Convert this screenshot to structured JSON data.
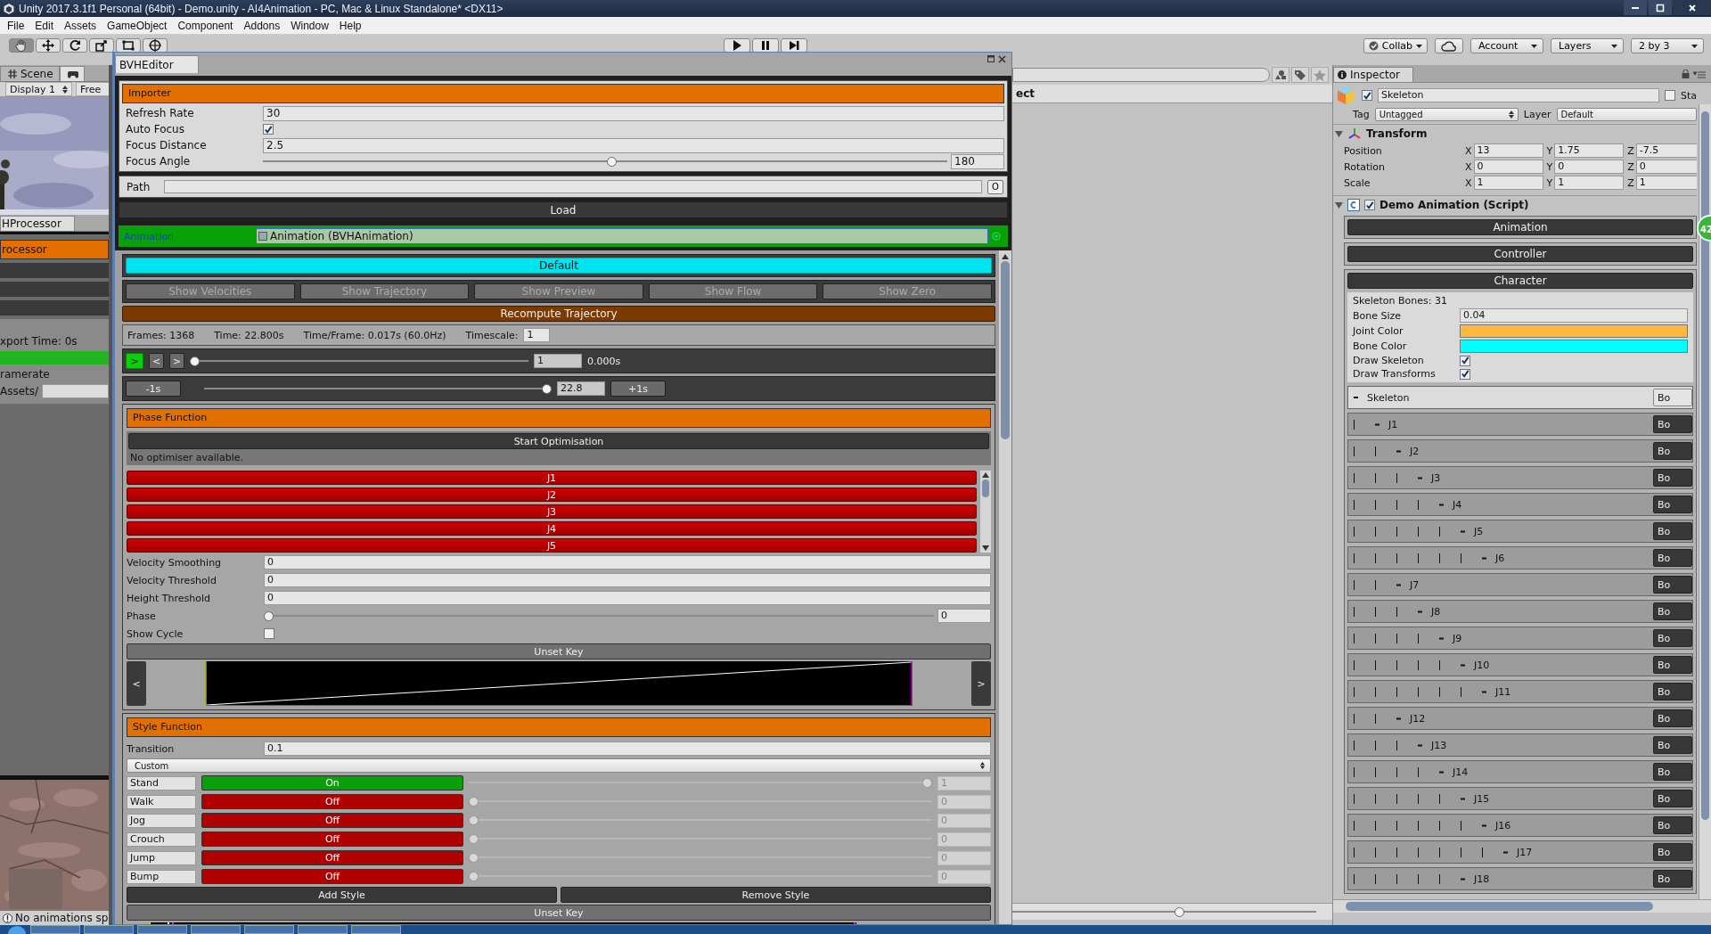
{
  "window": {
    "title": "Unity 2017.3.1f1 Personal (64bit) - Demo.unity - AI4Animation - PC, Mac & Linux Standalone* <DX11>"
  },
  "menu": [
    "File",
    "Edit",
    "Assets",
    "GameObject",
    "Component",
    "Addons",
    "Window",
    "Help"
  ],
  "toolbar": {
    "tools": [
      {
        "kind": "hand",
        "selected": true
      },
      {
        "kind": "move",
        "selected": false
      },
      {
        "kind": "rotate",
        "selected": false
      },
      {
        "kind": "scale",
        "selected": false
      },
      {
        "kind": "rect",
        "selected": false
      },
      {
        "kind": "transform",
        "selected": false
      }
    ],
    "playback": [
      {
        "kind": "play"
      },
      {
        "kind": "pause"
      },
      {
        "kind": "step"
      }
    ],
    "collab": "Collab",
    "account": "Account",
    "layers": "Layers",
    "layout": "2 by 3"
  },
  "scene_view": {
    "tabs": [
      {
        "label": "Scene",
        "selected": false
      },
      {
        "kind": "game",
        "selected": true
      }
    ],
    "display": "Display 1",
    "aspect": "Free"
  },
  "processor": {
    "tab": "HProcessor",
    "header": "rocessor",
    "export_time": "xport Time: 0s",
    "progress": {
      "level": 1
    },
    "framerate": "ramerate",
    "folder": "Assets/"
  },
  "status_bar": {
    "message": "No animations sp"
  },
  "project": {
    "header": "ect",
    "zoom": {
      "level": 0.55
    }
  },
  "editor": {
    "tab": "BVHEditor",
    "importer": {
      "title": "Importer",
      "fields": [
        {
          "kind": "text",
          "label": "Refresh Rate",
          "value": "30"
        },
        {
          "kind": "checkbox",
          "label": "Auto Focus",
          "checked": true
        },
        {
          "kind": "text",
          "label": "Focus Distance",
          "value": "2.5"
        },
        {
          "kind": "slider",
          "label": "Focus Angle",
          "level": 0.51,
          "value": "180"
        }
      ],
      "path": {
        "label": "Path",
        "button": "O"
      },
      "load": "Load"
    },
    "animation": {
      "label": "Animation",
      "value": "Animation (BVHAnimation)"
    },
    "default_button": "Default",
    "toggles": [
      {
        "label": "Show Velocities",
        "on": false
      },
      {
        "label": "Show Trajectory",
        "on": false
      },
      {
        "label": "Show Preview",
        "on": false
      },
      {
        "label": "Show Flow",
        "on": false
      },
      {
        "label": "Show Zero",
        "on": false
      }
    ],
    "recompute": "Recompute Trajectory",
    "info": [
      "Frames: 1368",
      "Time: 22.800s",
      "Time/Frame: 0.017s (60.0Hz)"
    ],
    "timescale": {
      "label": "Timescale:",
      "value": "1"
    },
    "playback": {
      "play": ">",
      "prev": "<",
      "next": ">",
      "level": 0,
      "frame": "1",
      "time": "0.000s"
    },
    "seek": {
      "back": "-1s",
      "level": 1,
      "value": "22.8",
      "forward": "+1s"
    },
    "phase": {
      "title": "Phase Function",
      "optimise": "Start Optimisation",
      "message": "No optimiser available.",
      "joints": [
        "J1",
        "J2",
        "J3",
        "J4",
        "J5"
      ],
      "fields": [
        {
          "kind": "text",
          "label": "Velocity Smoothing",
          "value": "0"
        },
        {
          "kind": "text",
          "label": "Velocity Threshold",
          "value": "0"
        },
        {
          "kind": "text",
          "label": "Height Threshold",
          "value": "0"
        },
        {
          "kind": "slider",
          "label": "Phase",
          "level": 0,
          "value": "0"
        },
        {
          "kind": "checkbox",
          "label": "Show Cycle",
          "checked": false
        }
      ],
      "unset": "Unset Key",
      "prev": "<",
      "next": ">"
    },
    "style": {
      "title": "Style Function",
      "transition": {
        "label": "Transition",
        "value": "0.1"
      },
      "mode": "Custom",
      "styles": [
        {
          "name": "Stand",
          "on": true,
          "state": "On",
          "level": 1,
          "value": "1",
          "disabled": true
        },
        {
          "name": "Walk",
          "on": false,
          "state": "Off",
          "level": 0,
          "value": "0",
          "disabled": true
        },
        {
          "name": "Jog",
          "on": false,
          "state": "Off",
          "level": 0,
          "value": "0",
          "disabled": true
        },
        {
          "name": "Crouch",
          "on": false,
          "state": "Off",
          "level": 0,
          "value": "0",
          "disabled": true
        },
        {
          "name": "Jump",
          "on": false,
          "state": "Off",
          "level": 0,
          "value": "0",
          "disabled": true
        },
        {
          "name": "Bump",
          "on": false,
          "state": "Off",
          "level": 0,
          "value": "0",
          "disabled": true
        }
      ],
      "add": "Add Style",
      "remove": "Remove Style",
      "unset": "Unset Key"
    }
  },
  "inspector": {
    "tab": "Inspector",
    "object": {
      "active": true,
      "name": "Skeleton",
      "static_label": "Sta",
      "static": false,
      "tag_label": "Tag",
      "tag": "Untagged",
      "layer_label": "Layer",
      "layer": "Default"
    },
    "transform": {
      "title": "Transform",
      "expanded": true,
      "rows": [
        {
          "label": "Position",
          "values": [
            {
              "axis": "X",
              "value": "13"
            },
            {
              "axis": "Y",
              "value": "1.75"
            },
            {
              "axis": "Z",
              "value": "-7.5"
            }
          ]
        },
        {
          "label": "Rotation",
          "values": [
            {
              "axis": "X",
              "value": "0"
            },
            {
              "axis": "Y",
              "value": "0"
            },
            {
              "axis": "Z",
              "value": "0"
            }
          ]
        },
        {
          "label": "Scale",
          "values": [
            {
              "axis": "X",
              "value": "1"
            },
            {
              "axis": "Y",
              "value": "1"
            },
            {
              "axis": "Z",
              "value": "1"
            }
          ]
        }
      ]
    },
    "script": {
      "title": "Demo Animation (Script)",
      "enabled": true,
      "expanded": true,
      "sections": [
        "Animation",
        "Controller",
        "Character"
      ],
      "character": {
        "bones": "Skeleton Bones: 31",
        "fields": [
          {
            "kind": "text",
            "label": "Bone Size",
            "value": "0.04"
          },
          {
            "kind": "color",
            "label": "Joint Color",
            "color": "#ffb83f"
          },
          {
            "kind": "color",
            "label": "Bone Color",
            "color": "#00ffff"
          },
          {
            "kind": "checkbox",
            "label": "Draw Skeleton",
            "checked": true
          },
          {
            "kind": "checkbox",
            "label": "Draw Transforms",
            "checked": true
          }
        ],
        "tree": {
          "name": "Skeleton",
          "button": "Bo",
          "children": [
            {
              "name": "J1",
              "button": "Bo",
              "children": [
                {
                  "name": "J2",
                  "button": "Bo",
                  "children": [
                    {
                      "name": "J3",
                      "button": "Bo",
                      "children": [
                        {
                          "name": "J4",
                          "button": "Bo",
                          "children": [
                            {
                              "name": "J5",
                              "button": "Bo",
                              "children": [
                                {
                                  "name": "J6",
                                  "button": "Bo"
                                }
                              ]
                            }
                          ]
                        }
                      ]
                    }
                  ]
                },
                {
                  "name": "J7",
                  "button": "Bo",
                  "children": [
                    {
                      "name": "J8",
                      "button": "Bo",
                      "children": [
                        {
                          "name": "J9",
                          "button": "Bo",
                          "children": [
                            {
                              "name": "J10",
                              "button": "Bo",
                              "children": [
                                {
                                  "name": "J11",
                                  "button": "Bo"
                                }
                              ]
                            }
                          ]
                        }
                      ]
                    }
                  ]
                },
                {
                  "name": "J12",
                  "button": "Bo",
                  "children": [
                    {
                      "name": "J13",
                      "button": "Bo",
                      "children": [
                        {
                          "name": "J14",
                          "button": "Bo",
                          "children": [
                            {
                              "name": "J15",
                              "button": "Bo",
                              "children": [
                                {
                                  "name": "J16",
                                  "button": "Bo",
                                  "children": [
                                    {
                                      "name": "J17",
                                      "button": "Bo"
                                    }
                                  ]
                                }
                              ]
                            },
                            {
                              "name": "J18",
                              "button": "Bo"
                            }
                          ]
                        }
                      ]
                    }
                  ]
                }
              ]
            }
          ]
        }
      }
    },
    "badge": "42"
  }
}
